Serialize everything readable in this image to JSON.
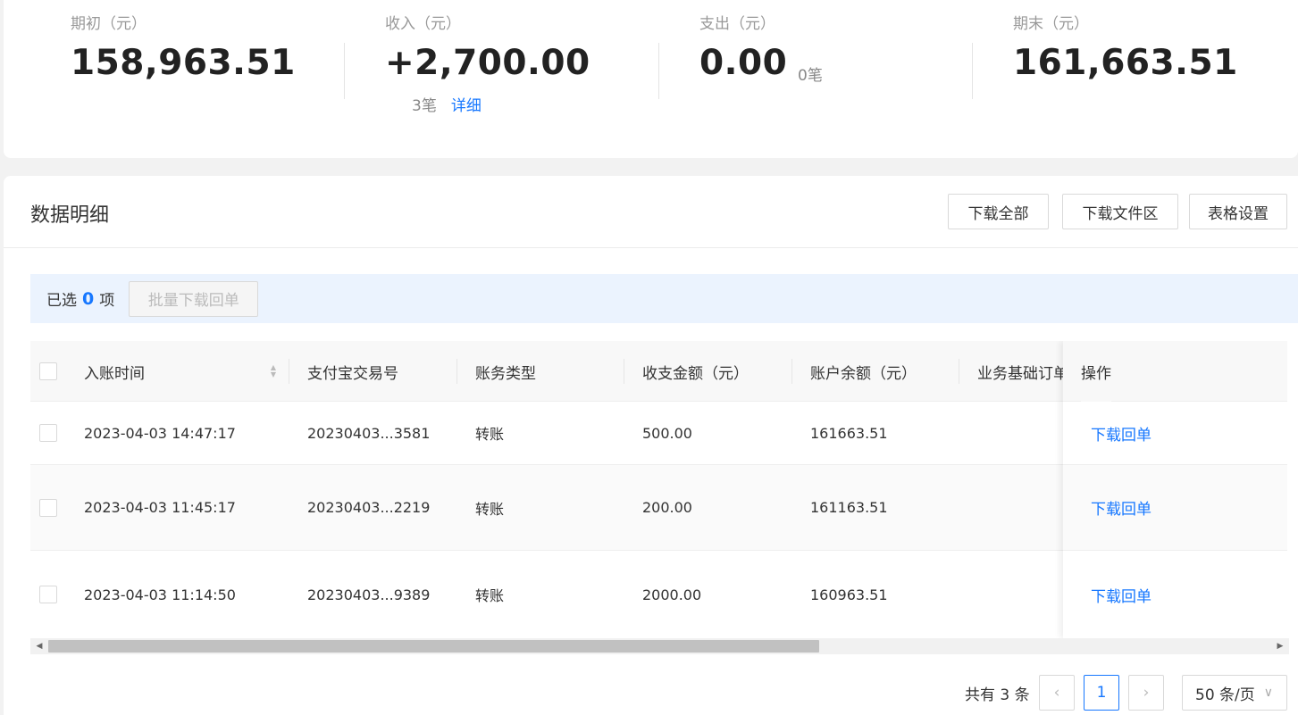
{
  "summary": {
    "opening": {
      "label": "期初（元）",
      "value": "158,963.51"
    },
    "income": {
      "label": "收入（元）",
      "value": "+2,700.00",
      "count": "3笔",
      "detail_link": "详细"
    },
    "expense": {
      "label": "支出（元）",
      "value": "0.00",
      "count": "0笔"
    },
    "closing": {
      "label": "期末（元）",
      "value": "161,663.51"
    }
  },
  "detail": {
    "title": "数据明细",
    "buttons": {
      "download_all": "下载全部",
      "download_area": "下载文件区",
      "table_settings": "表格设置"
    },
    "selection": {
      "prefix": "已选",
      "count": "0",
      "suffix": "项",
      "batch_button": "批量下载回单"
    },
    "columns": [
      "入账时间",
      "支付宝交易号",
      "账务类型",
      "收支金额（元）",
      "账户余额（元）",
      "业务基础订单号",
      "操作"
    ],
    "rows": [
      {
        "time": "2023-04-03 14:47:17",
        "trade_no": "20230403...3581",
        "type": "转账",
        "amount": "500.00",
        "balance": "161663.51",
        "action": "下载回单"
      },
      {
        "time": "2023-04-03 11:45:17",
        "trade_no": "20230403...2219",
        "type": "转账",
        "amount": "200.00",
        "balance": "161163.51",
        "action": "下载回单"
      },
      {
        "time": "2023-04-03 11:14:50",
        "trade_no": "20230403...9389",
        "type": "转账",
        "amount": "2000.00",
        "balance": "160963.51",
        "action": "下载回单"
      }
    ]
  },
  "pagination": {
    "total": "共有 3 条",
    "current_page": "1",
    "page_size": "50 条/页",
    "prev_icon": "chevron-left-icon",
    "next_icon": "chevron-right-icon"
  },
  "colors": {
    "accent": "#1677ff",
    "select_bar": "#ebf3fe"
  }
}
